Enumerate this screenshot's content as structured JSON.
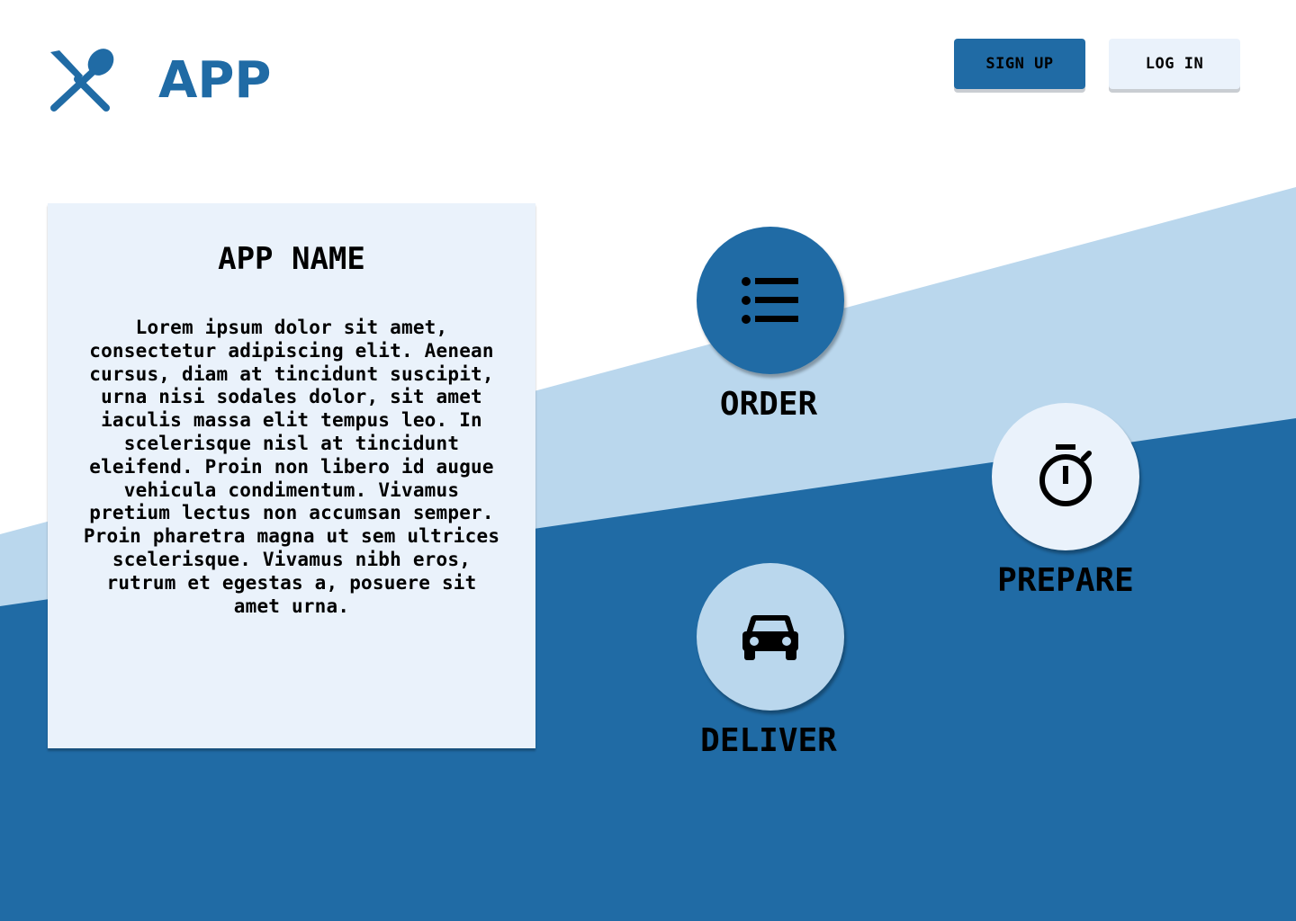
{
  "header": {
    "brand": "APP",
    "logo_icon": "fork-spoon-icon",
    "signup_label": "SIGN UP",
    "login_label": "LOG IN"
  },
  "info_card": {
    "title": "APP NAME",
    "body": "Lorem ipsum dolor sit amet, consectetur adipiscing elit. Aenean cursus, diam at tincidunt suscipit, urna nisi sodales dolor, sit amet iaculis massa elit tempus leo. In scelerisque nisl at tincidunt eleifend. Proin non libero id augue vehicula condimentum. Vivamus pretium lectus non accumsan semper. Proin pharetra magna ut sem ultrices scelerisque. Vivamus nibh eros, rutrum et egestas a, posuere sit amet urna."
  },
  "steps": [
    {
      "label": "ORDER",
      "icon": "list-icon"
    },
    {
      "label": "PREPARE",
      "icon": "stopwatch-icon"
    },
    {
      "label": "DELIVER",
      "icon": "car-icon"
    }
  ],
  "colors": {
    "primary": "#206ba5",
    "light_blue": "#bad7ed",
    "pale_blue": "#eaf2fb",
    "background": "#ffffff"
  }
}
